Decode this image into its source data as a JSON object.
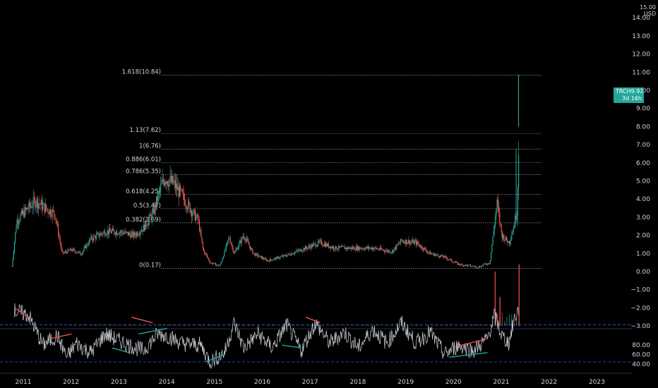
{
  "symbol_badge": {
    "ticker": "TRCH",
    "last_price": "9.92",
    "countdown": "3d 16h",
    "color": "#26a69a"
  },
  "currency_label": "USD",
  "price_axis": {
    "labels": [
      "−3.00",
      "−2.00",
      "−1.00",
      "0.00",
      "1.00",
      "2.00",
      "3.00",
      "4.00",
      "5.00",
      "6.00",
      "7.00",
      "8.00",
      "9.00",
      "10.00",
      "11.00",
      "12.00",
      "13.00",
      "14.00",
      "15.00"
    ],
    "min": -3,
    "max": 15
  },
  "rsi_axis": {
    "labels": [
      "40.00",
      "60.00",
      "80.00"
    ],
    "levels": [
      30,
      70
    ]
  },
  "time_axis": {
    "labels": [
      "2011",
      "2012",
      "2013",
      "2014",
      "2015",
      "2016",
      "2017",
      "2018",
      "2019",
      "2020",
      "2021",
      "2022",
      "2023"
    ]
  },
  "fib_levels": [
    {
      "label": "1.618(10.84)",
      "value": 10.84
    },
    {
      "label": "1.13(7.62)",
      "value": 7.62
    },
    {
      "label": "1(6.76)",
      "value": 6.76
    },
    {
      "label": "0.886(6.01)",
      "value": 6.01
    },
    {
      "label": "0.786(5.35)",
      "value": 5.35
    },
    {
      "label": "0.618(4.25)",
      "value": 4.25
    },
    {
      "label": "0.5(3.47)",
      "value": 3.47
    },
    {
      "label": "0.382(2.69)",
      "value": 2.69
    },
    {
      "label": "0(0.17)",
      "value": 0.17
    }
  ],
  "colors": {
    "up": "#26a69a",
    "down": "#ef5350",
    "rsi_line": "#d1d4dc",
    "rsi_band": "#2962ff",
    "divergence_bear": "#ef5350",
    "divergence_bull": "#26a69a"
  },
  "chart_data": {
    "type": "candlestick",
    "x_unit": "year",
    "price_anchors": [
      [
        2010.85,
        0.3
      ],
      [
        2010.95,
        2.8
      ],
      [
        2011.15,
        3.4
      ],
      [
        2011.35,
        3.9
      ],
      [
        2011.55,
        3.5
      ],
      [
        2011.75,
        3.2
      ],
      [
        2011.9,
        1.0
      ],
      [
        2012.1,
        1.2
      ],
      [
        2012.3,
        1.0
      ],
      [
        2012.5,
        1.8
      ],
      [
        2012.8,
        2.2
      ],
      [
        2013.1,
        2.2
      ],
      [
        2013.4,
        2.0
      ],
      [
        2013.6,
        2.4
      ],
      [
        2013.8,
        3.2
      ],
      [
        2013.95,
        4.5
      ],
      [
        2014.05,
        5.2
      ],
      [
        2014.25,
        4.8
      ],
      [
        2014.5,
        3.8
      ],
      [
        2014.75,
        2.8
      ],
      [
        2014.85,
        1.2
      ],
      [
        2015.0,
        0.5
      ],
      [
        2015.2,
        0.3
      ],
      [
        2015.4,
        1.9
      ],
      [
        2015.5,
        1.0
      ],
      [
        2015.7,
        2.0
      ],
      [
        2015.9,
        1.0
      ],
      [
        2016.2,
        0.6
      ],
      [
        2016.6,
        0.9
      ],
      [
        2017.0,
        1.3
      ],
      [
        2017.3,
        1.6
      ],
      [
        2017.6,
        1.3
      ],
      [
        2018.0,
        1.3
      ],
      [
        2018.4,
        1.3
      ],
      [
        2018.8,
        1.1
      ],
      [
        2019.0,
        1.7
      ],
      [
        2019.3,
        1.6
      ],
      [
        2019.6,
        1.0
      ],
      [
        2019.9,
        0.8
      ],
      [
        2020.2,
        0.4
      ],
      [
        2020.6,
        0.25
      ],
      [
        2020.85,
        0.5
      ],
      [
        2021.0,
        3.8
      ],
      [
        2021.1,
        2.0
      ],
      [
        2021.25,
        1.6
      ],
      [
        2021.35,
        2.5
      ],
      [
        2021.42,
        3.4
      ],
      [
        2021.45,
        6.5
      ],
      [
        2021.47,
        9.92
      ]
    ],
    "volume_spikes": [
      [
        2020.95,
        3.0
      ],
      [
        2021.05,
        1.6
      ],
      [
        2021.45,
        3.4
      ]
    ],
    "rsi_anchors": [
      [
        2010.9,
        85
      ],
      [
        2011.2,
        80
      ],
      [
        2011.5,
        48
      ],
      [
        2011.8,
        58
      ],
      [
        2012.0,
        35
      ],
      [
        2012.2,
        50
      ],
      [
        2012.5,
        40
      ],
      [
        2012.8,
        60
      ],
      [
        2013.0,
        55
      ],
      [
        2013.3,
        48
      ],
      [
        2013.6,
        42
      ],
      [
        2013.9,
        60
      ],
      [
        2014.1,
        58
      ],
      [
        2014.4,
        50
      ],
      [
        2014.8,
        48
      ],
      [
        2015.0,
        30
      ],
      [
        2015.3,
        40
      ],
      [
        2015.5,
        72
      ],
      [
        2015.7,
        45
      ],
      [
        2016.0,
        60
      ],
      [
        2016.3,
        45
      ],
      [
        2016.6,
        70
      ],
      [
        2016.9,
        42
      ],
      [
        2017.2,
        72
      ],
      [
        2017.5,
        50
      ],
      [
        2017.8,
        62
      ],
      [
        2018.1,
        45
      ],
      [
        2018.4,
        65
      ],
      [
        2018.7,
        50
      ],
      [
        2019.0,
        72
      ],
      [
        2019.3,
        50
      ],
      [
        2019.6,
        62
      ],
      [
        2019.9,
        38
      ],
      [
        2020.2,
        48
      ],
      [
        2020.5,
        42
      ],
      [
        2020.8,
        55
      ],
      [
        2020.95,
        80
      ],
      [
        2021.1,
        58
      ],
      [
        2021.25,
        50
      ],
      [
        2021.35,
        75
      ],
      [
        2021.45,
        86
      ]
    ],
    "rsi_divergences": [
      {
        "kind": "bear",
        "from": [
          2010.9,
          88
        ],
        "to": [
          2011.2,
          78
        ]
      },
      {
        "kind": "bear",
        "from": [
          2011.65,
          55
        ],
        "to": [
          2012.1,
          60
        ]
      },
      {
        "kind": "bear",
        "from": [
          2013.35,
          78
        ],
        "to": [
          2013.8,
          72
        ]
      },
      {
        "kind": "bull",
        "from": [
          2012.95,
          45
        ],
        "to": [
          2013.3,
          40
        ]
      },
      {
        "kind": "bull",
        "from": [
          2013.5,
          60
        ],
        "to": [
          2014.1,
          66
        ]
      },
      {
        "kind": "bull",
        "from": [
          2014.9,
          30
        ],
        "to": [
          2015.3,
          38
        ]
      },
      {
        "kind": "bull",
        "from": [
          2016.5,
          48
        ],
        "to": [
          2016.9,
          45
        ]
      },
      {
        "kind": "bear",
        "from": [
          2017.0,
          78
        ],
        "to": [
          2017.3,
          72
        ]
      },
      {
        "kind": "bear",
        "from": [
          2020.1,
          46
        ],
        "to": [
          2020.8,
          55
        ]
      },
      {
        "kind": "bull",
        "from": [
          2020.0,
          35
        ],
        "to": [
          2020.8,
          40
        ]
      }
    ]
  }
}
